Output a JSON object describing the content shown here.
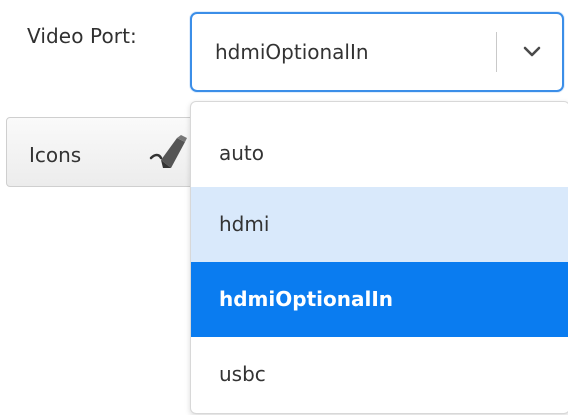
{
  "form": {
    "video_port_label": "Video Port:",
    "video_port_value": "hdmiOptionalIn",
    "icons_button_label": "Icons"
  },
  "dropdown": {
    "options": [
      {
        "label": "auto",
        "state": "normal"
      },
      {
        "label": "hdmi",
        "state": "hover"
      },
      {
        "label": "hdmiOptionalIn",
        "state": "selected"
      },
      {
        "label": "usbc",
        "state": "normal"
      }
    ]
  },
  "colors": {
    "focus_border": "#3b8ee8",
    "hover_bg": "#d9e9fb",
    "selected_bg": "#0a7cf0",
    "selected_text": "#ffffff"
  },
  "icons": {
    "select_chevron": "chevron-down-icon",
    "icons_button_glyph": "pen-icon"
  }
}
